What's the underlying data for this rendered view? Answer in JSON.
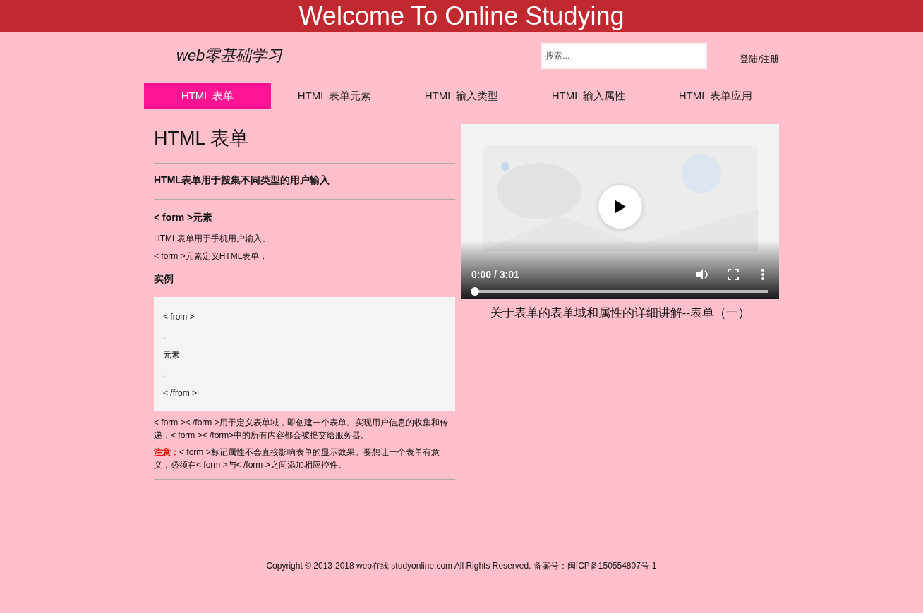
{
  "header": {
    "title": "Welcome To Online Studying"
  },
  "logo": "web零基础学习",
  "search": {
    "placeholder": "搜索..."
  },
  "login_link": "登陆/注册",
  "tabs": [
    {
      "label": "HTML 表单",
      "selected": true
    },
    {
      "label": "HTML 表单元素",
      "selected": false
    },
    {
      "label": "HTML 输入类型",
      "selected": false
    },
    {
      "label": "HTML 输入属性",
      "selected": false
    },
    {
      "label": "HTML 表单应用",
      "selected": false
    }
  ],
  "article": {
    "title": "HTML 表单",
    "subtitle": "HTML表单用于搜集不同类型的用户输入",
    "section_heading": "< form >元素",
    "paragraphs": [
      "HTML表单用于手机用户输入。",
      "< form >元素定义HTML表单；"
    ],
    "example_heading": "实例",
    "code_lines": [
      "< from >",
      ".",
      "元素",
      ".",
      "< /from >"
    ],
    "description": "< form >< /form >用于定义表单域，即创建一个表单。实现用户信息的收集和传递，< form >< /form>中的所有内容都会被提交给服务器。",
    "note": {
      "label": "注意：",
      "text": "< form >标记属性不会直接影响表单的显示效果。要想让一个表单有意义，必须在< form >与< /form >之间添加相应控件。"
    }
  },
  "video": {
    "kind": "picture",
    "time": "0:00 / 3:01",
    "level": 0,
    "caption": "关于表单的表单域和属性的详细讲解--表单（一）"
  },
  "footer": "Copyright © 2013-2018 web在线 studyonline.com All Rights Reserved. 备案号：闽ICP备150554807号-1"
}
